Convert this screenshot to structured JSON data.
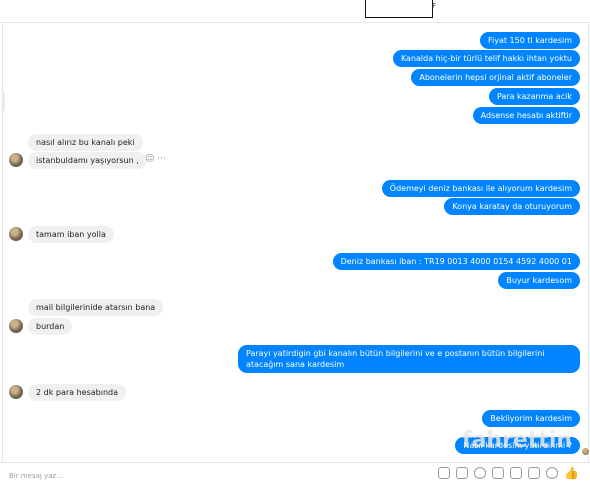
{
  "header": {
    "mark": "F"
  },
  "messages": {
    "m1": "Fiyat 150 tl kardesim",
    "m2": "Kanalda hiç-bir türlü telif hakkı ihtan yoktu",
    "m3": "Abonelerin hepsi orjinal aktif aboneler",
    "m4": "Para kazanma acik",
    "m5": "Adsense hesabı aktiftir",
    "m6": "nasıl alırız bu kanalı peki",
    "m7": "istanbuldamı yaşıyorsun ,",
    "m8": "Ödemeyi deniz bankası ile alıyorum kardesim",
    "m9": "Konya karatay da oturuyorum",
    "m10": "tamam iban yolla",
    "m11": "Deniz bankası iban : TR19 0013 4000 0154 4592 4000 01",
    "m12": "Buyur kardesom",
    "m13": "mail bilgilerinide atarsın bana",
    "m14": "burdan",
    "m15": "Parayı yatirdigin gbi kanalın bütün bilgilerini ve  e postanın bütün bilgilerini atacağım sana kardesim",
    "m16": "2 dk para hesabında",
    "m17": "Bekliyorim kardesim",
    "m18": "Nasıl kardesim yatirdinmi ?"
  },
  "message_actions": "☺ ···",
  "watermark": "fahrettin",
  "composer": {
    "placeholder": "Bir mesaj yaz...",
    "tools": [
      "sticker-icon",
      "gif-icon",
      "emoji-icon",
      "attach-icon",
      "game-icon",
      "camera-icon",
      "money-icon"
    ],
    "like_icon": "thumbs-up-icon",
    "accent_color": "#0084ff"
  }
}
